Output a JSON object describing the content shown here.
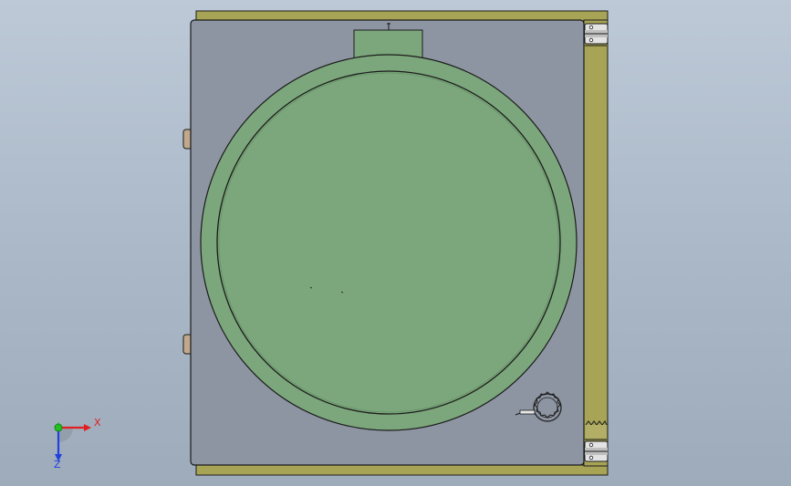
{
  "colors": {
    "background_top": "#bdc9d7",
    "background_bottom": "#9dabbb",
    "frame_olive": "#a8a456",
    "panel_gray": "#8d95a2",
    "disc_green": "#7ca77c",
    "edge_dark": "#1b1b1b",
    "axis_x": "#e02020",
    "axis_y": "#20c020",
    "axis_z": "#2040e0"
  },
  "icons": {
    "triad": "coordinate-triad-icon",
    "valve": "valve-knob-icon"
  },
  "triad": {
    "x_label": "X",
    "z_label": "Z"
  }
}
